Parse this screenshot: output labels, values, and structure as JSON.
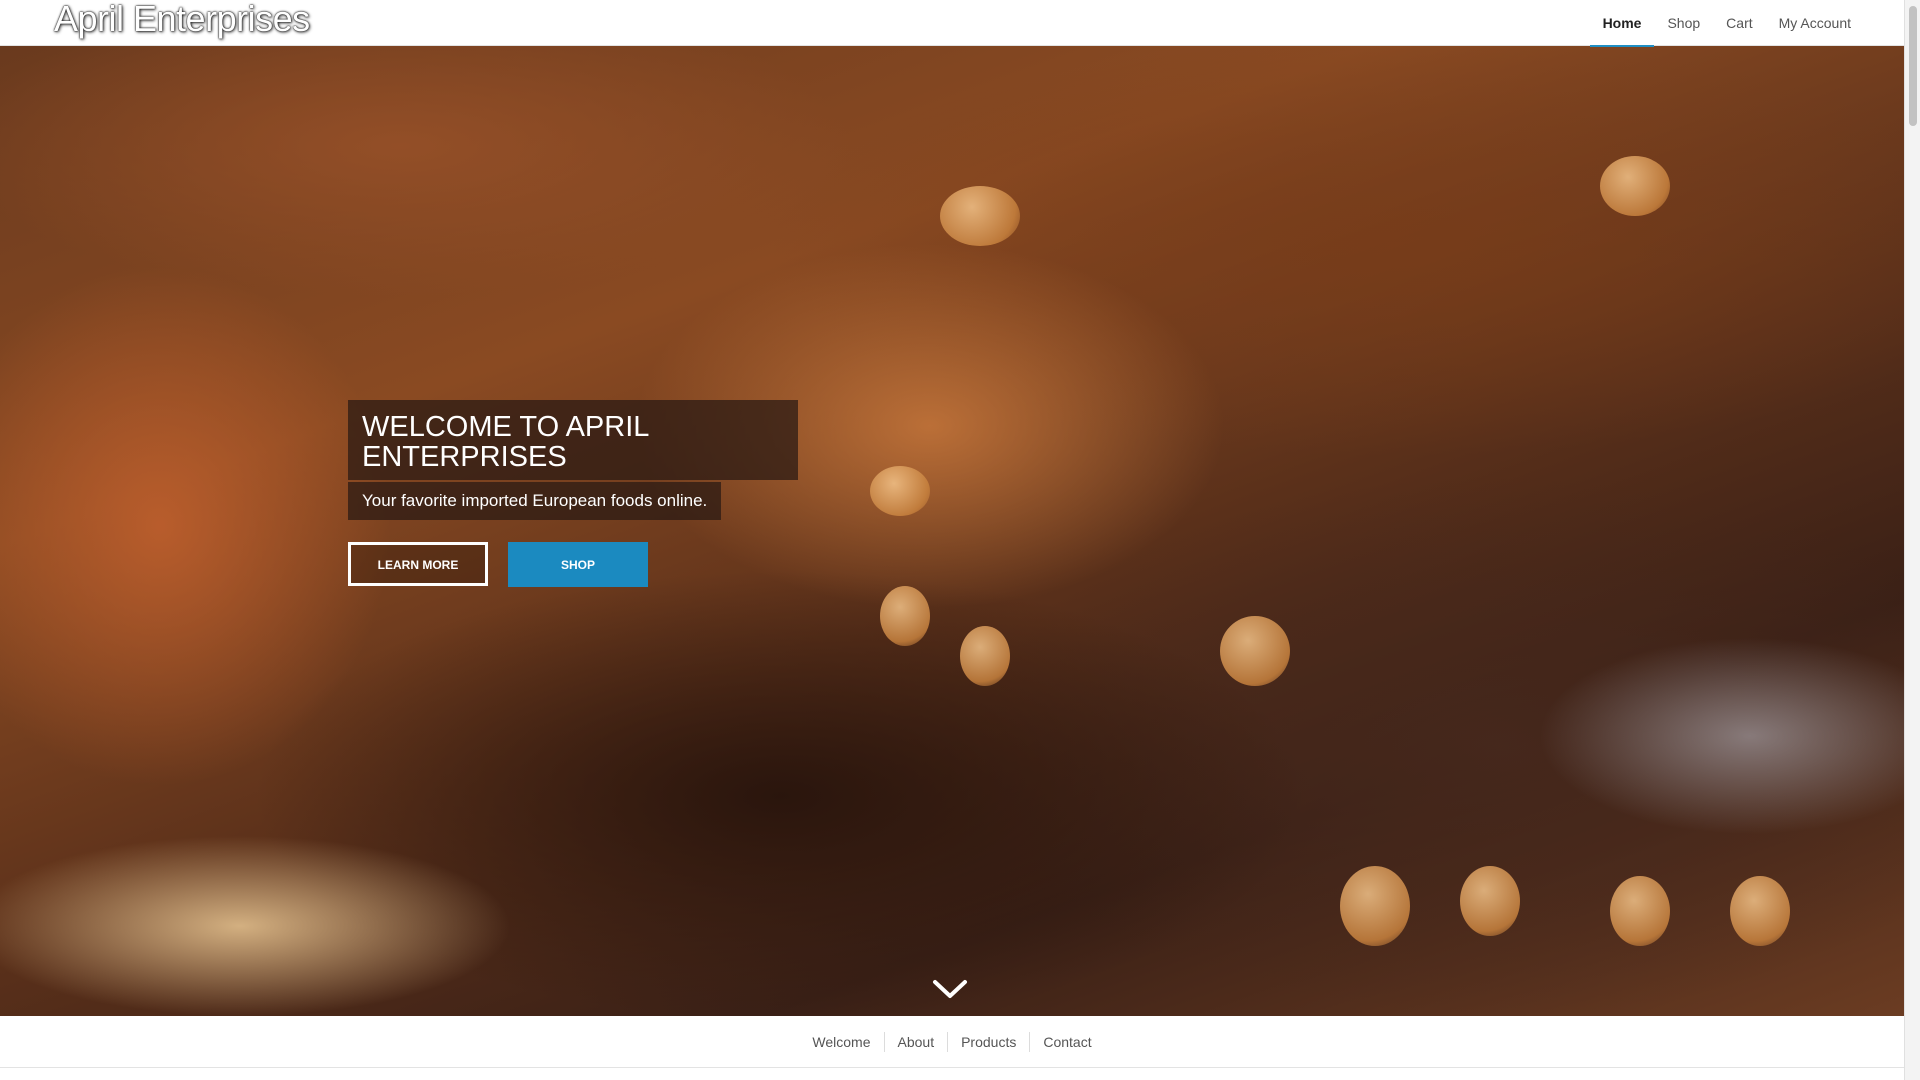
{
  "site": {
    "logo_text": "April Enterprises"
  },
  "nav": {
    "items": [
      {
        "label": "Home",
        "active": true
      },
      {
        "label": "Shop",
        "active": false
      },
      {
        "label": "Cart",
        "active": false
      },
      {
        "label": "My Account",
        "active": false
      }
    ],
    "accent_color": "#1f8fc4"
  },
  "hero": {
    "title": "WELCOME TO APRIL ENTERPRISES",
    "subtitle": "Your favorite imported European foods online.",
    "buttons": {
      "learn_more": "LEARN MORE",
      "shop": "SHOP"
    },
    "shop_button_color": "#1b8ac0",
    "scroll_icon": "chevron-down-icon"
  },
  "section_nav": {
    "items": [
      "Welcome",
      "About",
      "Products",
      "Contact"
    ]
  }
}
